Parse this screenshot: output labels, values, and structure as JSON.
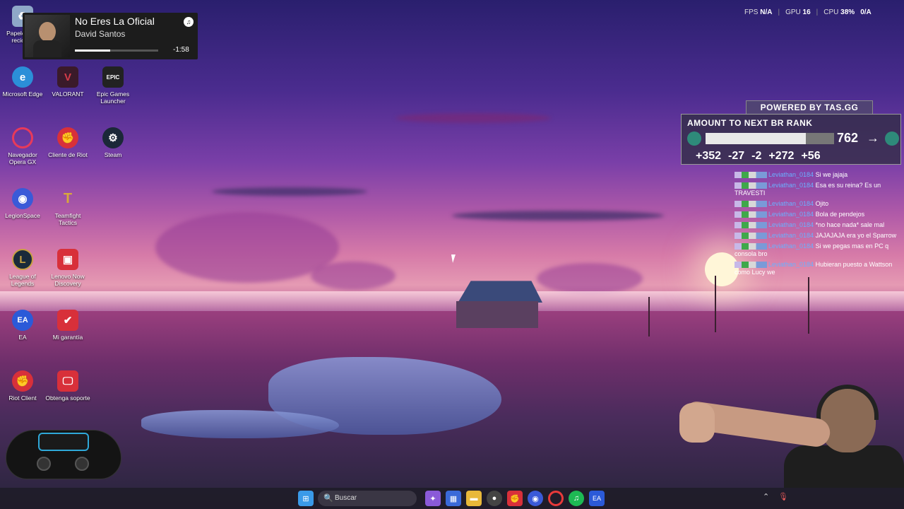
{
  "music_widget": {
    "title": "No Eres La Oficial",
    "artist": "David Santos",
    "remaining": "-1:58",
    "progress": 0.42
  },
  "desktop_icons": [
    {
      "label": "Papelera de reciclaje",
      "icon": "recycle-bin-icon",
      "color": "#8fa8c8"
    },
    {
      "label": "Microsoft Edge",
      "icon": "edge-icon",
      "color": "#2b8fd8"
    },
    {
      "label": "VALORANT",
      "icon": "valorant-icon",
      "color": "#d43b4a"
    },
    {
      "label": "Epic Games Launcher",
      "icon": "epic-games-icon",
      "color": "#222222"
    },
    {
      "label": "Navegador Opera GX",
      "icon": "opera-gx-icon",
      "color": "#e83a5a"
    },
    {
      "label": "Cliente de Riot",
      "icon": "riot-client-icon",
      "color": "#d8303a"
    },
    {
      "label": "Steam",
      "icon": "steam-icon",
      "color": "#1b2838"
    },
    {
      "label": "LegionSpace",
      "icon": "legionspace-icon",
      "color": "#3a5ad8"
    },
    {
      "label": "Teamfight Tactics",
      "icon": "tft-icon",
      "color": "#d8a83a"
    },
    {
      "label": "League of Legends",
      "icon": "lol-icon",
      "color": "#c8a040"
    },
    {
      "label": "Lenovo Now Discovery",
      "icon": "lenovo-now-icon",
      "color": "#d8303a"
    },
    {
      "label": "EA",
      "icon": "ea-icon",
      "color": "#2b5ad8"
    },
    {
      "label": "Mi garantía",
      "icon": "warranty-icon",
      "color": "#d8303a"
    },
    {
      "label": "Riot Client",
      "icon": "riot-client-icon",
      "color": "#d8303a"
    },
    {
      "label": "Obtenga soporte",
      "icon": "support-icon",
      "color": "#d8303a"
    }
  ],
  "stats": {
    "fps_label": "FPS",
    "fps_value": "N/A",
    "gpu_label": "GPU",
    "gpu_value": "16",
    "cpu_label": "CPU",
    "cpu_value": "38%",
    "ram_value": "0/A"
  },
  "rank": {
    "powered_by": "POWERED BY TAS.GG",
    "heading": "AMOUNT TO NEXT BR RANK",
    "points": "762",
    "arrow": "→",
    "progress": 0.78,
    "deltas": [
      "+352",
      "-27",
      "-2",
      "+272",
      "+56"
    ]
  },
  "chat": [
    {
      "user": "Leviathan_0184",
      "text": "Si we jajaja"
    },
    {
      "user": "Leviathan_0184",
      "text": "Esa es su reina? Es un TRAVESTI"
    },
    {
      "user": "Leviathan_0184",
      "text": "Ojito"
    },
    {
      "user": "Leviathan_0184",
      "text": "Bola de pendejos"
    },
    {
      "user": "Leviathan_0184",
      "text": "*no hace nada* sale mal"
    },
    {
      "user": "Leviathan_0184",
      "text": "JAJAJAJA era yo el Sparrow"
    },
    {
      "user": "Leviathan_0184",
      "text": "Si we pegas mas en PC q consola bro"
    },
    {
      "user": "Leviathan_0184",
      "text": "Hubieran puesto a Wattson como Lucy we"
    }
  ],
  "taskbar": {
    "search_placeholder": "Buscar",
    "apps": [
      {
        "icon": "windows-start-icon",
        "color": "#3a9ae8"
      },
      {
        "icon": "copilot-icon",
        "color": "#8a5ad8"
      },
      {
        "icon": "store-icon",
        "color": "#3a6ad8"
      },
      {
        "icon": "file-explorer-icon",
        "color": "#e8b83a"
      },
      {
        "icon": "obs-icon",
        "color": "#444444"
      },
      {
        "icon": "riot-icon",
        "color": "#d8303a"
      },
      {
        "icon": "legion-icon",
        "color": "#3a5ad8"
      },
      {
        "icon": "opera-icon",
        "color": "#e83a3a"
      },
      {
        "icon": "spotify-icon",
        "color": "#1db954"
      },
      {
        "icon": "ea-app-icon",
        "color": "#2b5ad8"
      }
    ]
  }
}
